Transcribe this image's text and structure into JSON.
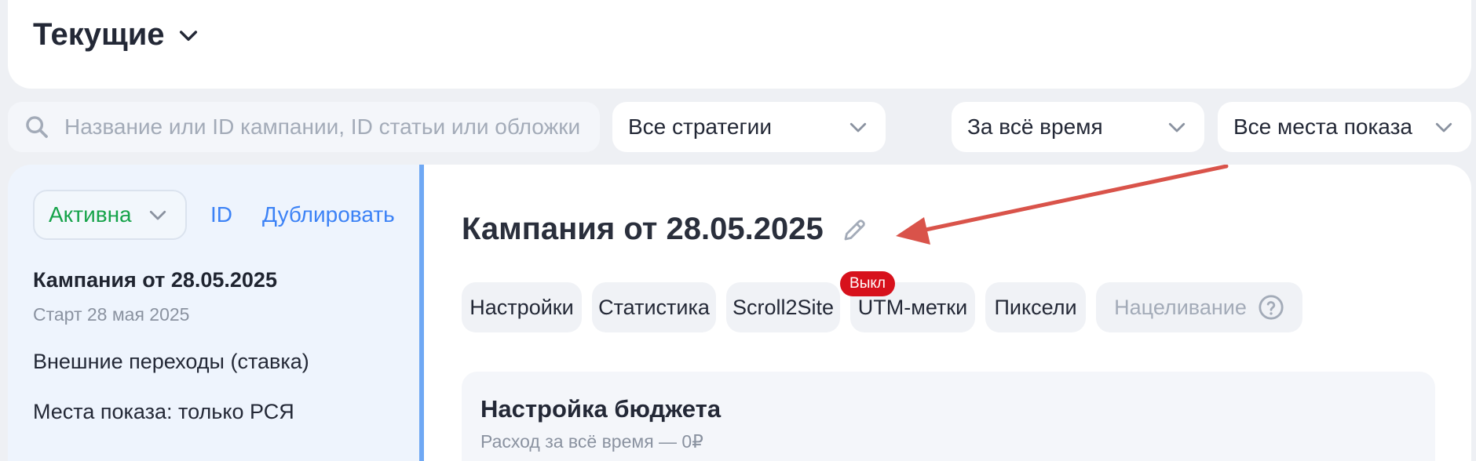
{
  "header": {
    "title": "Текущие"
  },
  "filters": {
    "search_placeholder": "Название или ID кампании, ID статьи или обложки",
    "strategy": "Все стратегии",
    "period": "За всё время",
    "placements": "Все места показа"
  },
  "sidebar": {
    "status": "Активна",
    "id_link": "ID",
    "duplicate_link": "Дублировать",
    "campaign_name": "Кампания от 28.05.2025",
    "start": "Старт 28 мая 2025",
    "goal": "Внешние переходы (ставка)",
    "placements": "Места показа: только РСЯ"
  },
  "main": {
    "title": "Кампания от 28.05.2025",
    "tabs": [
      {
        "label": "Настройки"
      },
      {
        "label": "Статистика"
      },
      {
        "label": "Scroll2Site",
        "badge": "Выкл"
      },
      {
        "label": "UTM-метки"
      },
      {
        "label": "Пиксели"
      },
      {
        "label": "Нацеливание",
        "disabled": true
      }
    ],
    "budget": {
      "title": "Настройка бюджета",
      "spend": "Расход за всё время — 0₽"
    }
  },
  "colors": {
    "accent_blue": "#3c82f6",
    "status_green": "#16a34a",
    "badge_red": "#d7111c",
    "annotation_arrow": "#d9534a"
  }
}
